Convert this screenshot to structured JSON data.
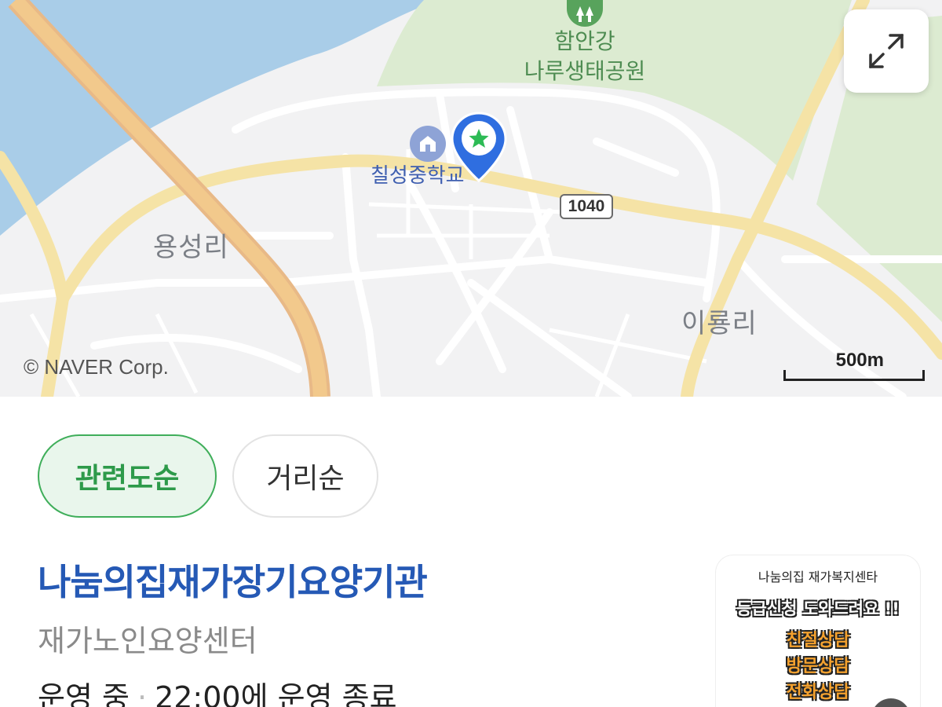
{
  "map": {
    "park_label_line1": "함안강",
    "park_label_line2": "나루생태공원",
    "school_label": "칠성중학교",
    "road_number": "1040",
    "place_left": "용성리",
    "place_right": "이룡리",
    "copyright": "© NAVER Corp.",
    "scale_label": "500m",
    "colors": {
      "water": "#a9cde8",
      "park": "#dcebd1",
      "road_major": "#f2c98c",
      "road_minor": "#f5e3a6",
      "pin": "#2f6ee0"
    }
  },
  "sort": {
    "active_label": "관련도순",
    "inactive_label": "거리순"
  },
  "place": {
    "name": "나눔의집재가장기요양기관",
    "category": "재가노인요양센터",
    "status": "운영 중",
    "hours_text": "22:00에 운영 종료",
    "thumbnail": {
      "title": "나눔의집 재가복지센타",
      "headline": "등급신청 도와드려요 !!",
      "lines": [
        "친절상담",
        "방문상담",
        "전화상담"
      ]
    }
  }
}
